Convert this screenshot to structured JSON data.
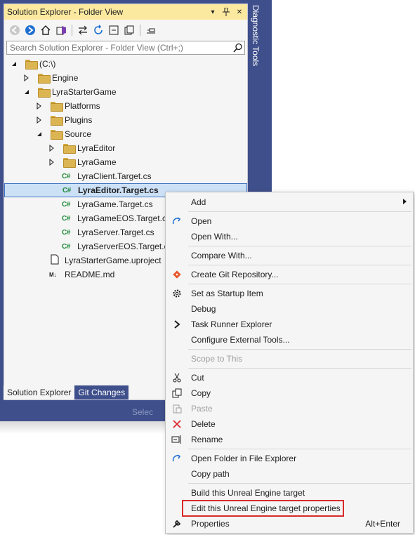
{
  "solution_explorer": {
    "title": "Solution Explorer - Folder View",
    "title_buttons": [
      "▾",
      "⊥",
      "✕"
    ],
    "search_placeholder": "Search Solution Explorer - Folder View (Ctrl+;)",
    "tree": [
      {
        "label": "(C:\\)",
        "type": "folder",
        "expanded": true,
        "level": 0
      },
      {
        "label": "Engine",
        "type": "folder",
        "expanded": false,
        "level": 1
      },
      {
        "label": "LyraStarterGame",
        "type": "folder",
        "expanded": true,
        "level": 1
      },
      {
        "label": "Platforms",
        "type": "folder",
        "expanded": false,
        "level": 2
      },
      {
        "label": "Plugins",
        "type": "folder",
        "expanded": false,
        "level": 2
      },
      {
        "label": "Source",
        "type": "folder",
        "expanded": true,
        "level": 2
      },
      {
        "label": "LyraEditor",
        "type": "folder",
        "expanded": false,
        "level": 3
      },
      {
        "label": "LyraGame",
        "type": "folder",
        "expanded": false,
        "level": 3
      },
      {
        "label": "LyraClient.Target.cs",
        "type": "cs",
        "level": 3
      },
      {
        "label": "LyraEditor.Target.cs",
        "type": "cs",
        "level": 3,
        "selected": true
      },
      {
        "label": "LyraGame.Target.cs",
        "type": "cs",
        "level": 3
      },
      {
        "label": "LyraGameEOS.Target.cs",
        "type": "cs",
        "level": 3
      },
      {
        "label": "LyraServer.Target.cs",
        "type": "cs",
        "level": 3
      },
      {
        "label": "LyraServerEOS.Target.cs",
        "type": "cs",
        "level": 3
      },
      {
        "label": "LyraStarterGame.uproject",
        "type": "file",
        "level": 2
      },
      {
        "label": "README.md",
        "type": "md",
        "level": 2
      }
    ],
    "cs_badge": "C#",
    "md_badge": "M↓",
    "tabs": [
      {
        "label": "Solution Explorer",
        "active": true
      },
      {
        "label": "Git Changes",
        "active": false
      }
    ],
    "bottom_faint": "Selec"
  },
  "side_panel": {
    "label": "Diagnostic Tools"
  },
  "context_menu": {
    "items": [
      {
        "label": "Add",
        "icon": "",
        "submenu": true
      },
      {
        "sep": true
      },
      {
        "label": "Open",
        "icon": "open-arrow-icon"
      },
      {
        "label": "Open With...",
        "icon": ""
      },
      {
        "sep": true
      },
      {
        "label": "Compare With...",
        "icon": ""
      },
      {
        "sep": true
      },
      {
        "label": "Create Git Repository...",
        "icon": "git-icon"
      },
      {
        "sep": true
      },
      {
        "label": "Set as Startup Item",
        "icon": "gear-icon"
      },
      {
        "label": "Debug",
        "icon": ""
      },
      {
        "label": "Task Runner Explorer",
        "icon": "chevron-right-icon"
      },
      {
        "label": "Configure External Tools...",
        "icon": ""
      },
      {
        "sep": true
      },
      {
        "label": "Scope to This",
        "icon": "",
        "disabled": true
      },
      {
        "sep": true
      },
      {
        "label": "Cut",
        "icon": "scissors-icon"
      },
      {
        "label": "Copy",
        "icon": "copy-icon"
      },
      {
        "label": "Paste",
        "icon": "paste-icon",
        "disabled": true
      },
      {
        "label": "Delete",
        "icon": "delete-x-icon"
      },
      {
        "label": "Rename",
        "icon": "rename-icon"
      },
      {
        "sep": true
      },
      {
        "label": "Open Folder in File Explorer",
        "icon": "open-arrow-icon"
      },
      {
        "label": "Copy path",
        "icon": ""
      },
      {
        "sep": true
      },
      {
        "label": "Build this Unreal Engine target",
        "icon": ""
      },
      {
        "label": "Edit this Unreal Engine target properties",
        "icon": "",
        "highlighted": true
      },
      {
        "label": "Properties",
        "icon": "wrench-icon",
        "shortcut": "Alt+Enter"
      }
    ]
  },
  "colors": {
    "frame": "#3e4f8b",
    "title_bg": "#fbe9a0",
    "selected_bg": "#cce0f6",
    "highlight_border": "#d92b2b",
    "cs_green": "#1f8a3a"
  }
}
